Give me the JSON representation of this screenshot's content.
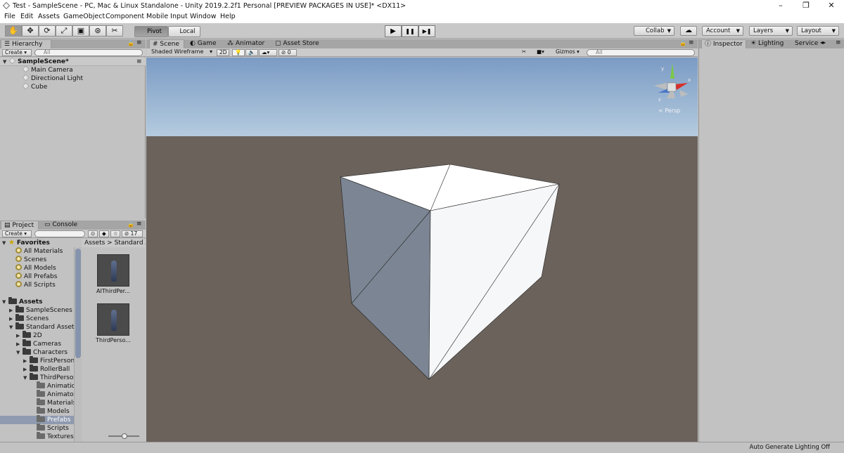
{
  "window": {
    "title": "Test - SampleScene - PC, Mac & Linux Standalone - Unity 2019.2.2f1 Personal [PREVIEW PACKAGES IN USE]* <DX11>",
    "controls": [
      "–",
      "❐",
      "✕"
    ]
  },
  "menu": [
    "File",
    "Edit",
    "Assets",
    "GameObject",
    "Component",
    "Mobile Input",
    "Window",
    "Help"
  ],
  "toolbar": {
    "tools": [
      "✋",
      "✥",
      "⟳",
      "⤢",
      "▣",
      "⊛",
      "✂"
    ],
    "pivot_label": "Pivot",
    "local_label": "Local",
    "play": "▶",
    "pause": "❚❚",
    "step": "▶❚",
    "collab_label": "Collab",
    "cloud": "☁",
    "account_label": "Account",
    "layers_label": "Layers",
    "layout_label": "Layout"
  },
  "hierarchy": {
    "tab": "Hierarchy",
    "create": "Create",
    "search_placeholder": "All",
    "scene_name": "SampleScene*",
    "items": [
      "Main Camera",
      "Directional Light",
      "Cube"
    ]
  },
  "scene_view": {
    "tabs": [
      "Scene",
      "Game",
      "Animator",
      "Asset Store"
    ],
    "draw_mode": "Shaded Wireframe",
    "mode_2d": "2D",
    "fx_count": "0",
    "gizmos_label": "Gizmos",
    "search_placeholder": "All",
    "persp_label": "Persp",
    "gizmo_y": "y",
    "gizmo_x": "x",
    "gizmo_z": "z"
  },
  "project": {
    "tabs": [
      "Project",
      "Console"
    ],
    "create": "Create",
    "count": "17",
    "favorites_label": "Favorites",
    "favorites": [
      "All Materials",
      "Scenes",
      "All Models",
      "All Prefabs",
      "All Scripts"
    ],
    "assets_label": "Assets",
    "tree": [
      {
        "label": "SampleScenes",
        "depth": 1,
        "arrow": "▶"
      },
      {
        "label": "Scenes",
        "depth": 1,
        "arrow": "▶"
      },
      {
        "label": "Standard Assets",
        "depth": 1,
        "arrow": "▼"
      },
      {
        "label": "2D",
        "depth": 2,
        "arrow": "▶"
      },
      {
        "label": "Cameras",
        "depth": 2,
        "arrow": "▶"
      },
      {
        "label": "Characters",
        "depth": 2,
        "arrow": "▼"
      },
      {
        "label": "FirstPerson",
        "depth": 3,
        "arrow": "▶"
      },
      {
        "label": "RollerBall",
        "depth": 3,
        "arrow": "▶"
      },
      {
        "label": "ThirdPerson",
        "depth": 3,
        "arrow": "▼"
      },
      {
        "label": "Animation",
        "depth": 4,
        "arrow": ""
      },
      {
        "label": "Animator",
        "depth": 4,
        "arrow": ""
      },
      {
        "label": "Materials",
        "depth": 4,
        "arrow": ""
      },
      {
        "label": "Models",
        "depth": 4,
        "arrow": ""
      },
      {
        "label": "Prefabs",
        "depth": 4,
        "arrow": "",
        "selected": true
      },
      {
        "label": "Scripts",
        "depth": 4,
        "arrow": ""
      },
      {
        "label": "Textures",
        "depth": 4,
        "arrow": ""
      }
    ],
    "breadcrumb": [
      "Assets",
      "Standard A"
    ],
    "breadcrumb_sep": ">",
    "prefabs": [
      "AIThirdPer...",
      "ThirdPerso..."
    ]
  },
  "inspector": {
    "tabs": [
      "Inspector",
      "Lighting",
      "Service"
    ]
  },
  "status": {
    "text": "Auto Generate Lighting Off"
  },
  "colors": {
    "scene_ground": "#6b625b",
    "sky_top": "#7f9fc6",
    "horizon": "#dfe6ea",
    "selection": "#8c9bb7"
  }
}
